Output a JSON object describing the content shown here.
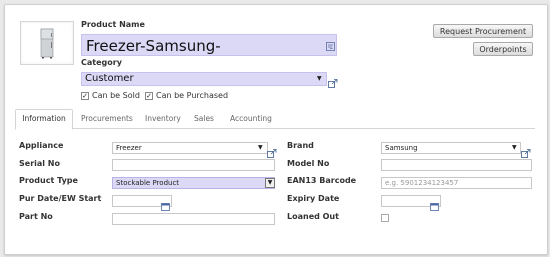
{
  "header": {
    "product_name_label": "Product Name",
    "product_name_value": "Freezer-Samsung-",
    "category_label": "Category",
    "category_value": "Customer",
    "can_be_sold_label": "Can be Sold",
    "can_be_sold_checked": true,
    "can_be_purchased_label": "Can be Purchased",
    "can_be_purchased_checked": true,
    "request_procurement_label": "Request Procurement",
    "orderpoints_label": "Orderpoints"
  },
  "tabs": [
    {
      "label": "Information",
      "active": true
    },
    {
      "label": "Procurements",
      "active": false
    },
    {
      "label": "Inventory",
      "active": false
    },
    {
      "label": "Sales",
      "active": false
    },
    {
      "label": "Accounting",
      "active": false
    }
  ],
  "left_fields": {
    "appliance_label": "Appliance",
    "appliance_value": "Freezer",
    "serial_label": "Serial No",
    "serial_value": "",
    "product_type_label": "Product Type",
    "product_type_value": "Stockable Product",
    "pur_date_label": "Pur Date/EW Start",
    "pur_date_value": "",
    "part_label": "Part No",
    "part_value": ""
  },
  "right_fields": {
    "brand_label": "Brand",
    "brand_value": "Samsung",
    "model_label": "Model No",
    "model_value": "",
    "ean_label": "EAN13 Barcode",
    "ean_placeholder": "e.g. 5901234123457",
    "expiry_label": "Expiry Date",
    "expiry_value": "",
    "loaned_label": "Loaned Out",
    "loaned_checked": false
  },
  "colors": {
    "required_field_bg": "#dcd9f7",
    "link_icon": "#3d5c8c"
  },
  "icons": {
    "external_link": "external-link-icon",
    "dropdown": "chevron-down-icon",
    "calendar": "calendar-icon",
    "translate": "translate-icon"
  }
}
